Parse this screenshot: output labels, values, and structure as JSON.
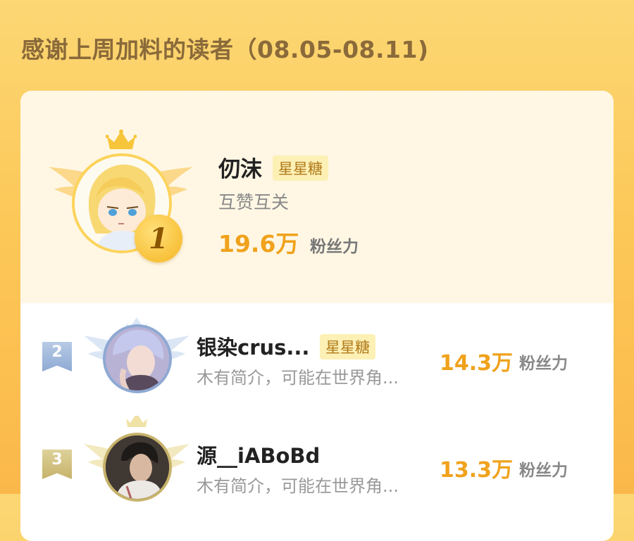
{
  "header": {
    "title": "感谢上周加料的读者（08.05-08.11)"
  },
  "ranking": [
    {
      "rank": "1",
      "name": "仞沫",
      "tag": "星星糖",
      "bio": "互赞互关",
      "fans_value": "19.6万",
      "fans_label": "粉丝力",
      "avatar_icon": "anime-avatar-icon"
    },
    {
      "rank": "2",
      "name": "银染crus...",
      "tag": "星星糖",
      "bio": "木有简介，可能在世界角...",
      "fans_value": "14.3万",
      "fans_label": "粉丝力",
      "avatar_icon": "anime-avatar-icon"
    },
    {
      "rank": "3",
      "name": "源__iABoBd",
      "bio": "木有简介，可能在世界角...",
      "fans_value": "13.3万",
      "fans_label": "粉丝力",
      "avatar_icon": "photo-avatar-icon"
    }
  ],
  "colors": {
    "accent": "#f0a21c",
    "gold": "#fcd35b",
    "silver": "#8ea9d3",
    "bronze": "#c6b26a"
  }
}
